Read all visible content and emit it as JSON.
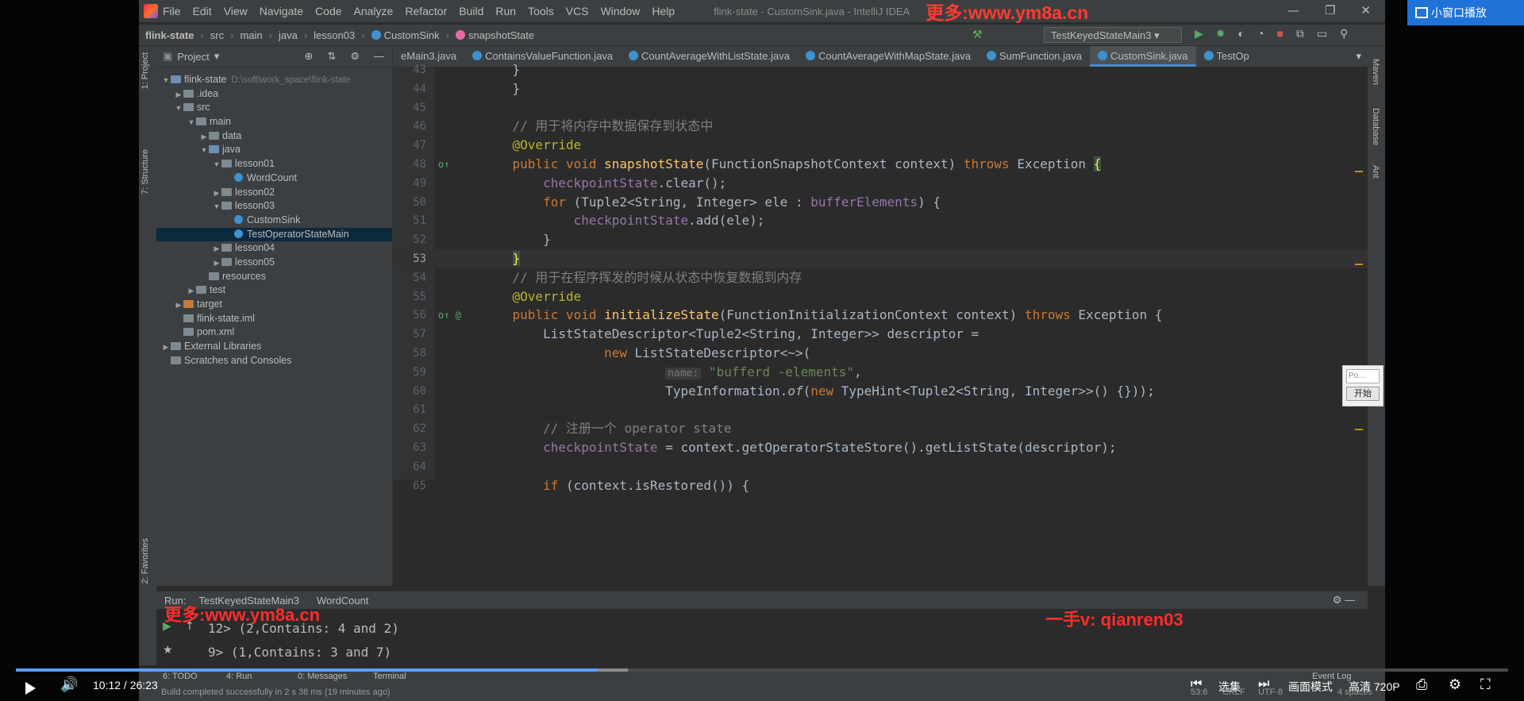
{
  "ide": {
    "menu": [
      "File",
      "Edit",
      "View",
      "Navigate",
      "Code",
      "Analyze",
      "Refactor",
      "Build",
      "Run",
      "Tools",
      "VCS",
      "Window",
      "Help"
    ],
    "window_title": "flink-state - CustomSink.java - IntelliJ IDEA",
    "watermark_top": "更多:www.ym8a.cn",
    "breadcrumb": [
      "flink-state",
      "src",
      "main",
      "java",
      "lesson03",
      "CustomSink",
      "snapshotState"
    ],
    "run_config": "TestKeyedStateMain3",
    "project_panel_title": "Project",
    "tree": [
      {
        "label": "flink-state",
        "extra": "D:\\soft\\work_space\\flink-state",
        "indent": 0,
        "arrow": "▼",
        "icon": "blue"
      },
      {
        "label": ".idea",
        "indent": 1,
        "arrow": "▶",
        "icon": "gray"
      },
      {
        "label": "src",
        "indent": 1,
        "arrow": "▼",
        "icon": "gray"
      },
      {
        "label": "main",
        "indent": 2,
        "arrow": "▼",
        "icon": "gray"
      },
      {
        "label": "data",
        "indent": 3,
        "arrow": "▶",
        "icon": "gray"
      },
      {
        "label": "java",
        "indent": 3,
        "arrow": "▼",
        "icon": "blue"
      },
      {
        "label": "lesson01",
        "indent": 4,
        "arrow": "▼",
        "icon": "gray"
      },
      {
        "label": "WordCount",
        "indent": 5,
        "arrow": "",
        "icon": "class"
      },
      {
        "label": "lesson02",
        "indent": 4,
        "arrow": "▶",
        "icon": "gray"
      },
      {
        "label": "lesson03",
        "indent": 4,
        "arrow": "▼",
        "icon": "gray"
      },
      {
        "label": "CustomSink",
        "indent": 5,
        "arrow": "",
        "icon": "class"
      },
      {
        "label": "TestOperatorStateMain",
        "indent": 5,
        "arrow": "",
        "icon": "class",
        "selected": true
      },
      {
        "label": "lesson04",
        "indent": 4,
        "arrow": "▶",
        "icon": "gray"
      },
      {
        "label": "lesson05",
        "indent": 4,
        "arrow": "▶",
        "icon": "gray"
      },
      {
        "label": "resources",
        "indent": 3,
        "arrow": "",
        "icon": "gray"
      },
      {
        "label": "test",
        "indent": 2,
        "arrow": "▶",
        "icon": "gray"
      },
      {
        "label": "target",
        "indent": 1,
        "arrow": "▶",
        "icon": "orange"
      },
      {
        "label": "flink-state.iml",
        "indent": 1,
        "arrow": "",
        "icon": "gray"
      },
      {
        "label": "pom.xml",
        "indent": 1,
        "arrow": "",
        "icon": "gray"
      },
      {
        "label": "External Libraries",
        "indent": 0,
        "arrow": "▶",
        "icon": "gray"
      },
      {
        "label": "Scratches and Consoles",
        "indent": 0,
        "arrow": "",
        "icon": "gray"
      }
    ],
    "tabs": [
      {
        "label": "eMain3.java",
        "active": false
      },
      {
        "label": "ContainsValueFunction.java",
        "active": false
      },
      {
        "label": "CountAverageWithListState.java",
        "active": false
      },
      {
        "label": "CountAverageWithMapState.java",
        "active": false
      },
      {
        "label": "SumFunction.java",
        "active": false
      },
      {
        "label": "CustomSink.java",
        "active": true
      },
      {
        "label": "TestOp",
        "active": false
      }
    ],
    "code_lines": [
      {
        "n": "43",
        "html": "<span class='tx'>    }</span>"
      },
      {
        "n": "44",
        "html": "<span class='tx'>    }</span>"
      },
      {
        "n": "45",
        "html": ""
      },
      {
        "n": "46",
        "html": "    <span class='cm'>// 用于将内存中数据保存到状态中</span>"
      },
      {
        "n": "47",
        "html": "    <span class='an'>@Override</span>"
      },
      {
        "n": "48",
        "html": "    <span class='kw'>public void </span><span class='fn'>snapshotState</span><span class='tx'>(FunctionSnapshotContext context) </span><span class='kw'>throws </span><span class='tx'>Exception </span><span class='brace'>{</span>"
      },
      {
        "n": "49",
        "html": "        <span class='fld'>checkpointState</span><span class='tx'>.clear();</span>"
      },
      {
        "n": "50",
        "html": "        <span class='kw'>for </span><span class='tx'>(Tuple2&lt;String, Integer&gt; ele : </span><span class='fld'>bufferElements</span><span class='tx'>) {</span>"
      },
      {
        "n": "51",
        "html": "            <span class='fld'>checkpointState</span><span class='tx'>.add(ele);</span>"
      },
      {
        "n": "52",
        "html": "        <span class='tx'>}</span>"
      },
      {
        "n": "53",
        "html": "    <span class='brace'>}</span>",
        "cur": true
      },
      {
        "n": "54",
        "html": "    <span class='cm'>// 用于在程序挥发的时候从状态中恢复数据到内存</span>"
      },
      {
        "n": "55",
        "html": "    <span class='an'>@Override</span>"
      },
      {
        "n": "56",
        "html": "    <span class='kw'>public void </span><span class='fn'>initializeState</span><span class='tx'>(FunctionInitializationContext context) </span><span class='kw'>throws </span><span class='tx'>Exception {</span>"
      },
      {
        "n": "57",
        "html": "        <span class='tx'>ListStateDescriptor&lt;Tuple2&lt;String, Integer&gt;&gt; descriptor =</span>"
      },
      {
        "n": "58",
        "html": "                <span class='kw'>new </span><span class='tx'>ListStateDescriptor&lt;~&gt;(</span>"
      },
      {
        "n": "59",
        "html": "                        <span class='hint'>name:</span> <span class='st'>\"bufferd -elements\"</span><span class='tx'>,</span>"
      },
      {
        "n": "60",
        "html": "                        <span class='tx'>TypeInformation.</span><span class='it'>of</span><span class='tx'>(</span><span class='kw'>new </span><span class='tx'>TypeHint&lt;Tuple2&lt;String, Integer&gt;&gt;() {}));</span>"
      },
      {
        "n": "61",
        "html": ""
      },
      {
        "n": "62",
        "html": "        <span class='cm'>// 注册一个 operator state</span>"
      },
      {
        "n": "63",
        "html": "        <span class='fld'>checkpointState</span><span class='tx'> = context.getOperatorStateStore().getListState(descriptor);</span>"
      },
      {
        "n": "64",
        "html": ""
      },
      {
        "n": "65",
        "html": "        <span class='kw'>if </span><span class='tx'>(context.isRestored()) {</span>"
      }
    ],
    "run_panel": {
      "label": "Run:",
      "tabs": [
        "TestKeyedStateMain3",
        "WordCount"
      ],
      "output": [
        "12> (2,Contains: 4 and 2)",
        "9> (1,Contains: 3 and 7)"
      ],
      "watermark_left": "更多:www.ym8a.cn",
      "watermark_right": "一手v: qianren03"
    },
    "bottom_tools": [
      "6: TODO",
      "4: Run",
      "0: Messages",
      "Terminal",
      "Event Log"
    ],
    "status_text": "Build completed successfully in 2 s 38 ms (19 minutes ago)",
    "status_right": [
      "53:6",
      "CRLF",
      "UTF-8",
      "4 spaces"
    ],
    "left_stripe": [
      "1: Project",
      "7: Structure",
      "2: Favorites"
    ],
    "right_stripe": [
      "Maven",
      "Database",
      "Ant"
    ]
  },
  "popup": {
    "placeholder": "Po...",
    "button": "开始"
  },
  "mini_window": "小窗口播放",
  "player": {
    "time": "10:12 / 26:23",
    "select_label": "选集",
    "mode_label": "画面模式",
    "quality_label": "高清 720P",
    "progress": 0.39,
    "buffered": 0.41
  },
  "colors": {
    "accent": "#1f72d8",
    "ide_bg": "#2b2b2b",
    "panel_bg": "#3c3f41"
  }
}
